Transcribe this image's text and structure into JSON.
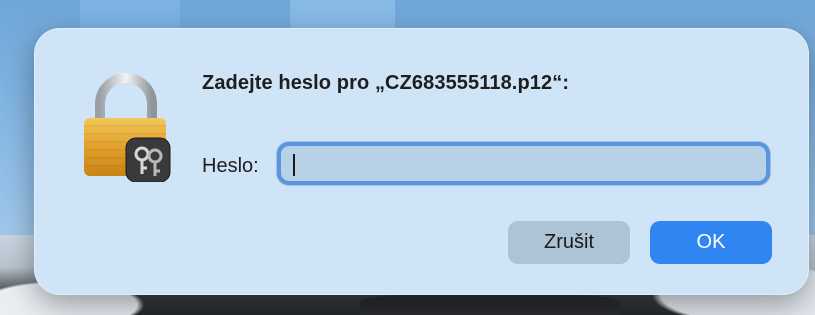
{
  "dialog": {
    "title": "Zadejte heslo pro „CZ683555118.p12“:",
    "password_label": "Heslo:",
    "password_value": "",
    "cancel_label": "Zrušit",
    "ok_label": "OK"
  },
  "icons": {
    "app_icon": "keychain-lock-icon"
  },
  "colors": {
    "accent": "#2f86f2",
    "focus_ring": "#5b95de",
    "dialog_bg": "#cfe5f7"
  }
}
